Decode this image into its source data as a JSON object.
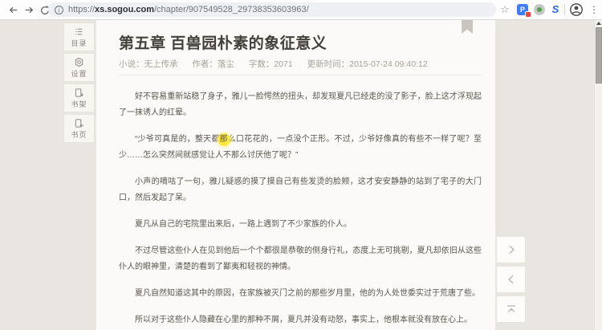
{
  "browser": {
    "url": {
      "scheme": "https://",
      "domain": "xs.sogou.com",
      "path": "/chapter/907549528_29738353603963/"
    },
    "info_glyph": "i",
    "star_glyph": "☆",
    "menu_glyph": "⋮",
    "extensions": {
      "p_letter": "P",
      "s_letter": "S"
    }
  },
  "sidebar": {
    "items": [
      {
        "label": "目录",
        "icon": "toc-list-icon"
      },
      {
        "label": "设置",
        "icon": "settings-gear-icon"
      },
      {
        "label": "书架",
        "icon": "bookshelf-add-icon"
      },
      {
        "label": "书页",
        "icon": "bookpage-back-icon"
      }
    ]
  },
  "reader": {
    "title": "第五章 百兽园朴素的象征意义",
    "meta": {
      "novel": "小说：无上传承",
      "author": "作者：落尘",
      "word_count": "字数：2071",
      "updated": "更新时间：2015-07-24 09:40:12"
    },
    "paragraphs": [
      {
        "text": "好不容易重新站稳了身子，雅儿一脸愕然的扭头，却发现夏凡已经走的没了影子，脸上这才浮现起了一抹诱人的红晕。"
      },
      {
        "before": "“少爷可真是的，整天都",
        "highlight": "那",
        "after": "么口花花的，一点没个正形。不过，少爷好像真的有些不一样了呢？至少……怎么突然间就感觉让人不那么讨厌他了呢？”"
      },
      {
        "text": "小声的嘀咕了一句，雅儿疑惑的摸了摸自己有些发烫的脸颊，这才安安静静的站到了宅子的大门口，然后发起了呆。"
      },
      {
        "text": "夏凡从自己的宅院里出来后，一路上遇到了不少家族的仆人。"
      },
      {
        "text": "不过尽管这些仆人在见到他后一个个都很是恭敬的侧身行礼，态度上无可挑剔，夏凡却依旧从这些仆人的眼神里，清楚的看到了鄙夷和轻视的神情。"
      },
      {
        "text": "夏凡自然知道这其中的原因，在家族被灭门之前的那些岁月里，他的为人处世委实过于荒唐了些。"
      },
      {
        "text": "所以对于这些仆人隐藏在心里的那种不屑，夏凡并没有动怒，事实上，他根本就没有放在心上。"
      }
    ]
  },
  "colors": {
    "page_background": "#e9e6e2",
    "paper_background": "#fbfaf8",
    "highlight_yellow": "#ffe93b",
    "bookmark_gray": "#c9c5c0",
    "extension_blue": "#3d7cf4",
    "extension_badge_red": "#e8453c",
    "sogou_blue": "#2f6ae0"
  }
}
